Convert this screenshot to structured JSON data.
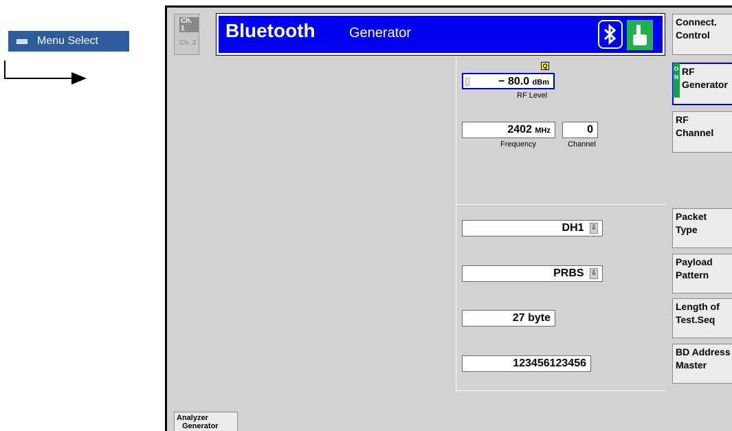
{
  "annotation": {
    "menu_select_label": "Menu Select"
  },
  "channel": {
    "ch1": "Ch. 1",
    "ch2": "Ch. 2"
  },
  "title": {
    "main": "Bluetooth",
    "sub": "Generator"
  },
  "softkeys": {
    "connect_control": [
      "Connect.",
      "Control"
    ],
    "rf_generator": [
      "RF",
      "Generator"
    ],
    "rf_generator_indicator": [
      "O",
      "N"
    ],
    "rf_channel": [
      "RF",
      "Channel"
    ],
    "packet_type": [
      "Packet",
      "Type"
    ],
    "payload_pattern": [
      "Payload",
      "Pattern"
    ],
    "length_of_test_seq": [
      "Length of",
      "Test.Seq"
    ],
    "bd_address_master": [
      "BD Address",
      "Master"
    ]
  },
  "rf": {
    "badge": "Q",
    "level_value": "− 80.0",
    "level_unit": "dBm",
    "level_caption": "RF Level",
    "frequency_value": "2402",
    "frequency_unit": "MHz",
    "frequency_caption": "Frequency",
    "channel_value": "0",
    "channel_caption": "Channel"
  },
  "packet": {
    "type_value": "DH1",
    "payload_value": "PRBS",
    "length_value": "27 byte",
    "bd_address_value": "123456123456"
  },
  "bottom_tab": [
    "Analyzer",
    "Generator"
  ]
}
